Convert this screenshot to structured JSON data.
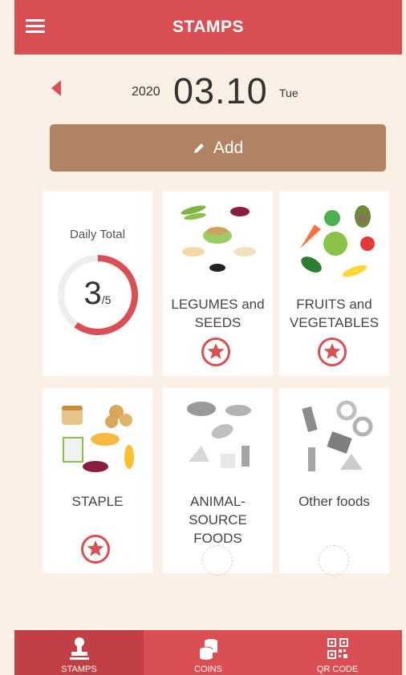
{
  "header": {
    "title": "STAMPS",
    "menu_icon": "hamburger-menu-icon"
  },
  "date": {
    "year": "2020",
    "month_day": "03.10",
    "weekday": "Tue",
    "prev_icon": "left-caret-icon"
  },
  "add_button": {
    "label": "Add",
    "icon": "pencil-icon"
  },
  "daily_total": {
    "label": "Daily Total",
    "count": "3",
    "denominator": "/5",
    "progress_fraction": 0.6
  },
  "categories": [
    {
      "name": "LEGUMES and SEEDS",
      "stamped": true
    },
    {
      "name": "FRUITS and VEGETABLES",
      "stamped": true
    },
    {
      "name": "STAPLE",
      "stamped": true
    },
    {
      "name": "ANIMAL-SOURCE FOODS",
      "stamped": false
    },
    {
      "name": "Other foods",
      "stamped": false
    }
  ],
  "bottom_nav": [
    {
      "label": "STAMPS",
      "icon": "stamp-icon",
      "active": true
    },
    {
      "label": "COINS",
      "icon": "coins-icon",
      "active": false
    },
    {
      "label": "QR CODE",
      "icon": "qr-code-icon",
      "active": false
    }
  ],
  "colors": {
    "brand_red": "#d94f53",
    "add_button_brown": "#b08462",
    "background": "#faf0e6"
  }
}
